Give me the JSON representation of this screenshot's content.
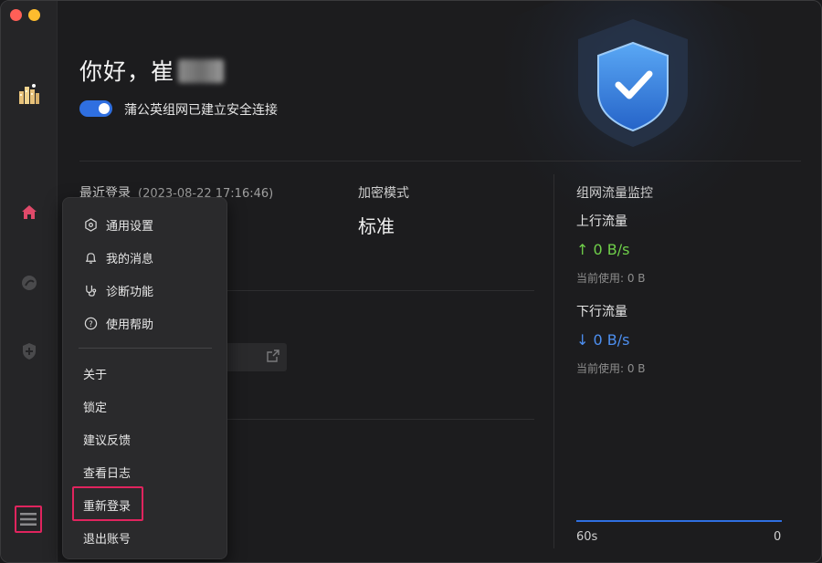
{
  "greeting": {
    "hello": "你好，崔"
  },
  "connection": {
    "status_text": "蒲公英组网已建立安全连接",
    "enabled": true
  },
  "last_login": {
    "label": "最近登录",
    "time": "(2023-08-22 17:16:46)"
  },
  "encryption": {
    "label": "加密模式",
    "value": "标准"
  },
  "traffic": {
    "title": "组网流量监控",
    "up": {
      "label": "上行流量",
      "rate": "0 B/s",
      "used": "当前使用: 0 B"
    },
    "down": {
      "label": "下行流量",
      "rate": "0 B/s",
      "used": "当前使用: 0 B"
    },
    "axis_left": "60s",
    "axis_right": "0"
  },
  "menu": {
    "items_with_icons": [
      {
        "label": "通用设置",
        "icon": "settings-hex-icon"
      },
      {
        "label": "我的消息",
        "icon": "bell-icon"
      },
      {
        "label": "诊断功能",
        "icon": "stethoscope-icon"
      },
      {
        "label": "使用帮助",
        "icon": "help-circle-icon"
      }
    ],
    "items": [
      {
        "label": "关于"
      },
      {
        "label": "锁定"
      },
      {
        "label": "建议反馈"
      },
      {
        "label": "查看日志"
      },
      {
        "label": "重新登录"
      },
      {
        "label": "退出账号"
      }
    ]
  },
  "colors": {
    "accent": "#2f6fe0",
    "up": "#6fcf4a",
    "down": "#4d8ff0",
    "highlight": "#e0245e",
    "active_nav": "#e04a6a"
  }
}
